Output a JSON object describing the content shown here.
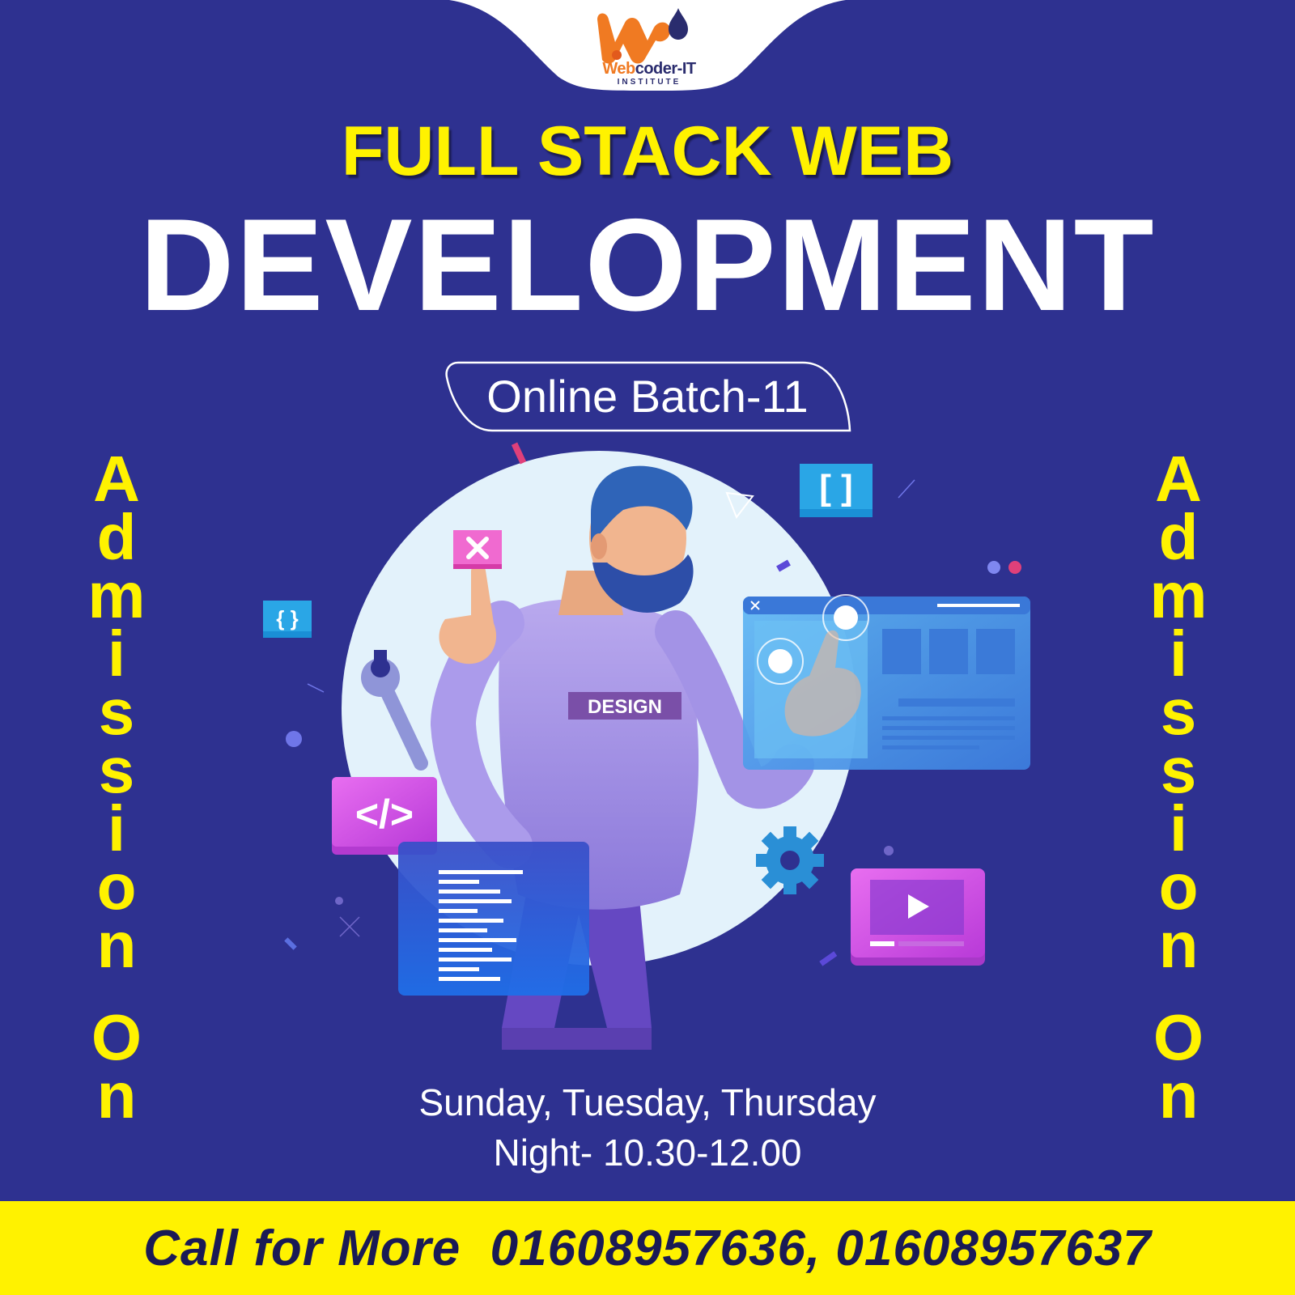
{
  "brand": {
    "name_part1": "Web",
    "name_part2": "coder-IT",
    "subtitle": "INSTITUTE"
  },
  "headline": {
    "line1": "FULL STACK WEB",
    "line2": "DEVELOPMENT"
  },
  "batch": {
    "label": "Online Batch-11"
  },
  "side_label": {
    "text": "Admission On",
    "letters": [
      "A",
      "d",
      "m",
      "i",
      "s",
      "s",
      "i",
      "o",
      "n",
      "O",
      "n"
    ]
  },
  "illustration": {
    "shirt_text": "DESIGN",
    "bracket_text": "[ ]",
    "small_bracket_text": "{ }",
    "code_text": "</>"
  },
  "schedule": {
    "days": "Sunday, Tuesday, Thursday",
    "time": "Night- 10.30-12.00"
  },
  "footer": {
    "text": "Call for More  01608957636, 01608957637"
  },
  "colors": {
    "background": "#2e3190",
    "accent_yellow": "#fff200",
    "logo_orange": "#f07a22",
    "logo_navy": "#2a2c6e"
  }
}
